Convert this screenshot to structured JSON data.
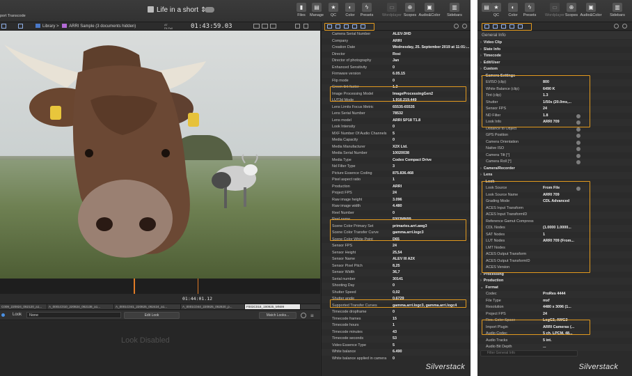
{
  "app": {
    "title": "Life in a short",
    "brand": "Silverstack",
    "accent": "#e39a1e"
  },
  "toolbar": {
    "left_cut": "port Transcode",
    "buttons": [
      "Files",
      "Manage",
      "QC",
      "Color",
      "Presets",
      "Wordplayer",
      "Scopes",
      "Audio&Color",
      "Sidebars"
    ],
    "right_buttons": [
      "",
      "QC",
      "Color",
      "Presets",
      "Wordplayer",
      "Scopes",
      "Audio&Color",
      "Sidebars"
    ]
  },
  "subbar": {
    "crumb_root": "Library",
    "crumb_sep": ">",
    "crumb_item": "ARRI Sample (3 documents hidden)",
    "at_label": "AT",
    "fit_label": "Fit",
    "zoom_label": "Full",
    "timecode": "01:43:59.03"
  },
  "timeline": {
    "timecode": "01:44:01.12",
    "clips": [
      "C009_220824_062120_a1...",
      "A_0001C010_220824_062138_a1...",
      "A_0001C041_220825_062424_a1...",
      "A_0001C044_220825_062820_p...",
      "F003C018_190925_MN99"
    ]
  },
  "look_bar": {
    "label": "Look",
    "select_value": "None",
    "edit_button": "Edit Look",
    "match_button": "Match Looks...",
    "disabled_text": "Look Disabled"
  },
  "meta_left": {
    "rows": [
      {
        "k": "Camera Serial Number",
        "v": "ALEV-3HD"
      },
      {
        "k": "Company",
        "v": "ARRI"
      },
      {
        "k": "Creation Date",
        "v": "Wednesday, 25. September 2019 at 11:01:..."
      },
      {
        "k": "Director",
        "v": "Rosi"
      },
      {
        "k": "Director of photography",
        "v": "Jan"
      },
      {
        "k": "Enhanced Sensitivity",
        "v": "0"
      },
      {
        "k": "Firmware version",
        "v": "6.05.15"
      },
      {
        "k": "Flip mode",
        "v": "0"
      },
      {
        "k": "Green tint factor",
        "v": "1.3"
      },
      {
        "k": "Image Processing Model",
        "v": "ImageProcessingGen2"
      },
      {
        "k": "LUT3d Mode",
        "v": "1.916.219.449"
      },
      {
        "k": "Lens Limits Focus Metric",
        "v": "65535-65535"
      },
      {
        "k": "Lens Serial Number",
        "v": "78532"
      },
      {
        "k": "Lens model",
        "v": "ARRI SP18 T1.8"
      },
      {
        "k": "Look Intensity",
        "v": "0"
      },
      {
        "k": "MXF Number Of Audio Channels",
        "v": "5"
      },
      {
        "k": "Media Capacity",
        "v": "0"
      },
      {
        "k": "Media Manufacturer",
        "v": "X2X Ltd."
      },
      {
        "k": "Media Serial Number",
        "v": "10020038"
      },
      {
        "k": "Media Type",
        "v": "Codex Compact Drive"
      },
      {
        "k": "Nd Filter Type",
        "v": "3"
      },
      {
        "k": "Picture Essence Coding",
        "v": "875.836.468"
      },
      {
        "k": "Pixel aspect ratio",
        "v": "1"
      },
      {
        "k": "Production",
        "v": "ARRI"
      },
      {
        "k": "Project FPS",
        "v": "24"
      },
      {
        "k": "Raw image height",
        "v": "3.096"
      },
      {
        "k": "Raw image width",
        "v": "4.480"
      },
      {
        "k": "Reel Number",
        "v": "0"
      },
      {
        "k": "Reel name",
        "v": "F003MN99"
      },
      {
        "k": "Scene Color Primary Set",
        "v": "primaries.arri.awg3"
      },
      {
        "k": "Scene Color Transfer Curve",
        "v": "gamma.arri.logc3"
      },
      {
        "k": "Scene Color White Point",
        "v": "D65"
      },
      {
        "k": "Sensor FPS",
        "v": "24"
      },
      {
        "k": "Sensor Height",
        "v": "25,54"
      },
      {
        "k": "Sensor Name",
        "v": "ALEV III A2X"
      },
      {
        "k": "Sensor Pixel Pitch",
        "v": "8,25"
      },
      {
        "k": "Sensor Width",
        "v": "36,7"
      },
      {
        "k": "Serial number",
        "v": "30141"
      },
      {
        "k": "Shooting Day",
        "v": "0"
      },
      {
        "k": "Shutter Speed",
        "v": "0,02"
      },
      {
        "k": "Shutter angle",
        "v": "0,6729"
      },
      {
        "k": "Supported Transfer Curves",
        "v": "gamma.arri.logc3, gamma.arri.logc4"
      },
      {
        "k": "Timecode dropframe",
        "v": "0"
      },
      {
        "k": "Timecode frames",
        "v": "15"
      },
      {
        "k": "Timecode hours",
        "v": "1"
      },
      {
        "k": "Timecode minutes",
        "v": "43"
      },
      {
        "k": "Timecode seconds",
        "v": "53"
      },
      {
        "k": "Video Essence Type",
        "v": "5"
      },
      {
        "k": "White balance",
        "v": "6.490"
      },
      {
        "k": "White balance applied in camera",
        "v": "0"
      }
    ]
  },
  "meta_right": {
    "header": "General Info",
    "filter_placeholder": "Filter General Info",
    "rows": [
      {
        "k": "Video Clip",
        "v": "",
        "sec": true
      },
      {
        "k": "Slate Info",
        "v": "",
        "sec": true
      },
      {
        "k": "Timecode",
        "v": "",
        "sec": true
      },
      {
        "k": "Edit/User",
        "v": "",
        "sec": true
      },
      {
        "k": "Custom",
        "v": "",
        "sec": true
      },
      {
        "k": "Camera Settings",
        "v": "",
        "sec": true,
        "open": true
      },
      {
        "k": "EI/ISO (clip)",
        "v": "800"
      },
      {
        "k": "White Balance (clip)",
        "v": "6490 K"
      },
      {
        "k": "Tint (clip)",
        "v": "1.3"
      },
      {
        "k": "Shutter",
        "v": "1/50s (20.0ms,..."
      },
      {
        "k": "Sensor FPS",
        "v": "24"
      },
      {
        "k": "ND Filter",
        "v": "1.8",
        "gear": true
      },
      {
        "k": "Look Info",
        "v": "ARRI 709",
        "gear": true
      },
      {
        "k": "Distance to Object",
        "v": "",
        "gear": true
      },
      {
        "k": "GPS Position",
        "v": "",
        "gear": true
      },
      {
        "k": "Camera Orientation",
        "v": "",
        "gear": true
      },
      {
        "k": "Native ISO",
        "v": "",
        "gear": true
      },
      {
        "k": "Camera Tilt [°]",
        "v": "",
        "gear": true
      },
      {
        "k": "Camera Roll [°]",
        "v": "",
        "gear": true
      },
      {
        "k": "Camera/Recorder",
        "v": "",
        "sec": true
      },
      {
        "k": "Lens",
        "v": "",
        "sec": true
      },
      {
        "k": "Look",
        "v": "",
        "sec": true,
        "open": true
      },
      {
        "k": "Look Source",
        "v": "From File",
        "gear": true
      },
      {
        "k": "Look Source Name",
        "v": "ARRI 709"
      },
      {
        "k": "Grading Mode",
        "v": "CDL Advanced"
      },
      {
        "k": "ACES Input Transform",
        "v": ""
      },
      {
        "k": "ACES Input TransformID",
        "v": ""
      },
      {
        "k": "Reference Gamut Compress",
        "v": ""
      },
      {
        "k": "CDL Nodes",
        "v": "(1.0000 1.0000..."
      },
      {
        "k": "SAT Nodes",
        "v": "1"
      },
      {
        "k": "LUT Nodes",
        "v": "ARRI 709 (From..."
      },
      {
        "k": "LMT Nodes",
        "v": ""
      },
      {
        "k": "ACES Output Transform",
        "v": ""
      },
      {
        "k": "ACES Output TransformID",
        "v": ""
      },
      {
        "k": "ACES Version",
        "v": ""
      },
      {
        "k": "Processing",
        "v": "",
        "sec": true
      },
      {
        "k": "Production",
        "v": "",
        "sec": true
      },
      {
        "k": "Format",
        "v": "",
        "sec": true,
        "open": true
      },
      {
        "k": "Codec",
        "v": "ProRes 4444"
      },
      {
        "k": "File Type",
        "v": "mxf"
      },
      {
        "k": "Resolution",
        "v": "4480 x 3096 (1..."
      },
      {
        "k": "Project FPS",
        "v": "24"
      },
      {
        "k": "Rec. Color Space",
        "v": "LogC3, AWG3"
      },
      {
        "k": "Import Plugin",
        "v": "ARRI Cameras (..."
      },
      {
        "k": "Audio Codec",
        "v": "5 ch, LPCM, 48..."
      },
      {
        "k": "Audio Tracks",
        "v": "5 int."
      },
      {
        "k": "Audio Bit Depth",
        "v": "..."
      }
    ]
  }
}
